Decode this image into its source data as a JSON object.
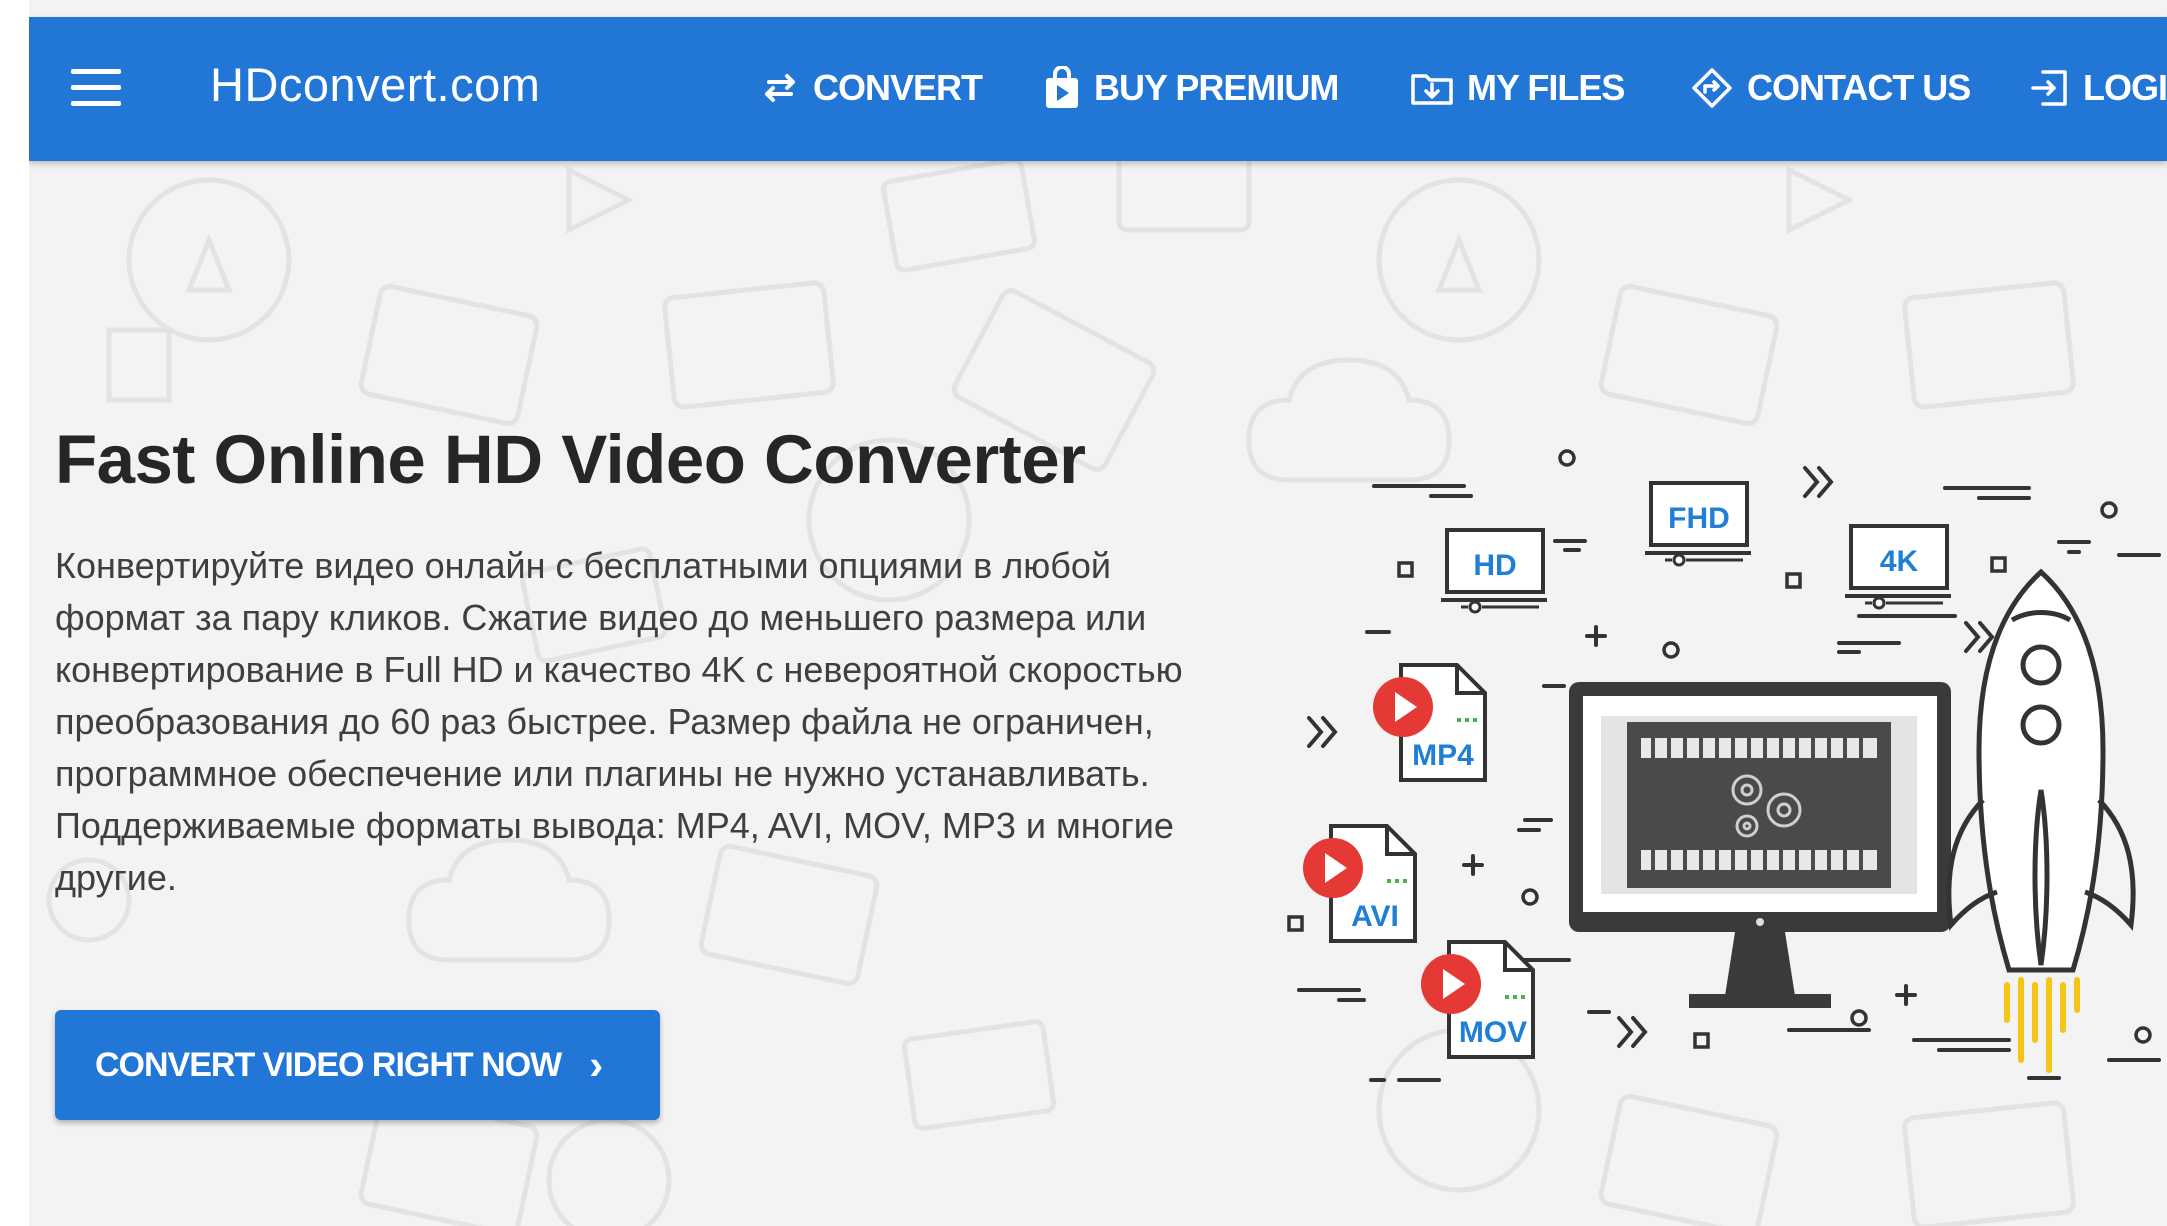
{
  "site": {
    "logo_text": "HDconvert.com"
  },
  "nav": {
    "menu_icon": "hamburger-menu-icon",
    "items": [
      {
        "label": "CONVERT",
        "icon": "swap-arrows-icon"
      },
      {
        "label": "BUY PREMIUM",
        "icon": "shopping-bag-icon"
      },
      {
        "label": "MY FILES",
        "icon": "folder-download-icon"
      },
      {
        "label": "CONTACT US",
        "icon": "diamond-direction-icon"
      },
      {
        "label": "LOGIN",
        "icon": "login-icon"
      }
    ]
  },
  "hero": {
    "title": "Fast Online HD Video Converter",
    "description": "Конвертируйте видео онлайн с бесплатными опциями в любой формат за пару кликов. Сжатие видео до меньшего размера или конвертирование в Full HD и качество 4K с невероятной скоростью преобразования до 60 раз быстрее. Размер файла не ограничен, программное обеспечение или плагины не нужно устанавливать. Поддерживаемые форматы вывода: MP4, AVI, MOV, MP3 и многие другие.",
    "cta_label": "CONVERT VIDEO RIGHT NOW",
    "cta_icon": "chevron-right-icon"
  },
  "illustration": {
    "screens": [
      "HD",
      "FHD",
      "4K"
    ],
    "files": [
      "MP4",
      "AVI",
      "MOV"
    ]
  },
  "colors": {
    "brand": "#2276d6",
    "heading": "#262626",
    "body_text": "#3f3f3f",
    "file_label": "#1f7fd6",
    "play_red": "#e53935",
    "flame_yellow": "#f5c518"
  }
}
